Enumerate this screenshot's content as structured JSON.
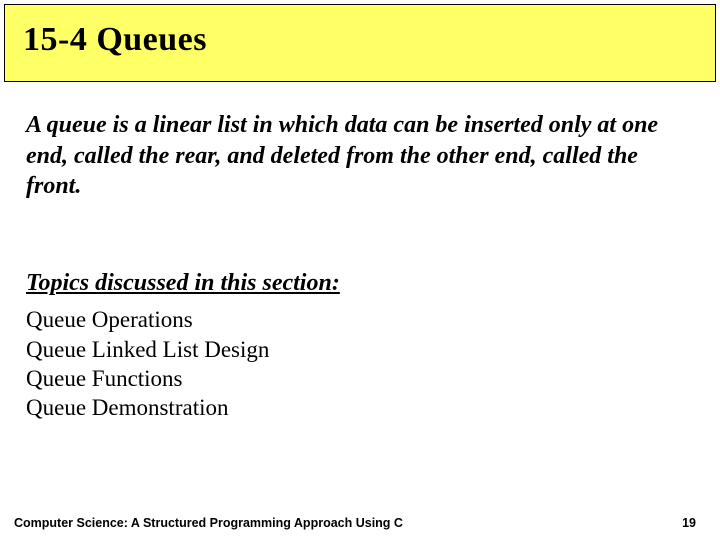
{
  "title": "15-4   Queues",
  "definition": "A queue is a linear list in which data can be inserted only at one end, called the rear, and deleted from the other end, called the front.",
  "topics_heading": "Topics discussed in this section:",
  "topics": [
    "Queue Operations",
    "Queue Linked List Design",
    "Queue Functions",
    "Queue Demonstration"
  ],
  "footer": {
    "left": "Computer Science: A Structured Programming Approach Using C",
    "right": "19"
  }
}
